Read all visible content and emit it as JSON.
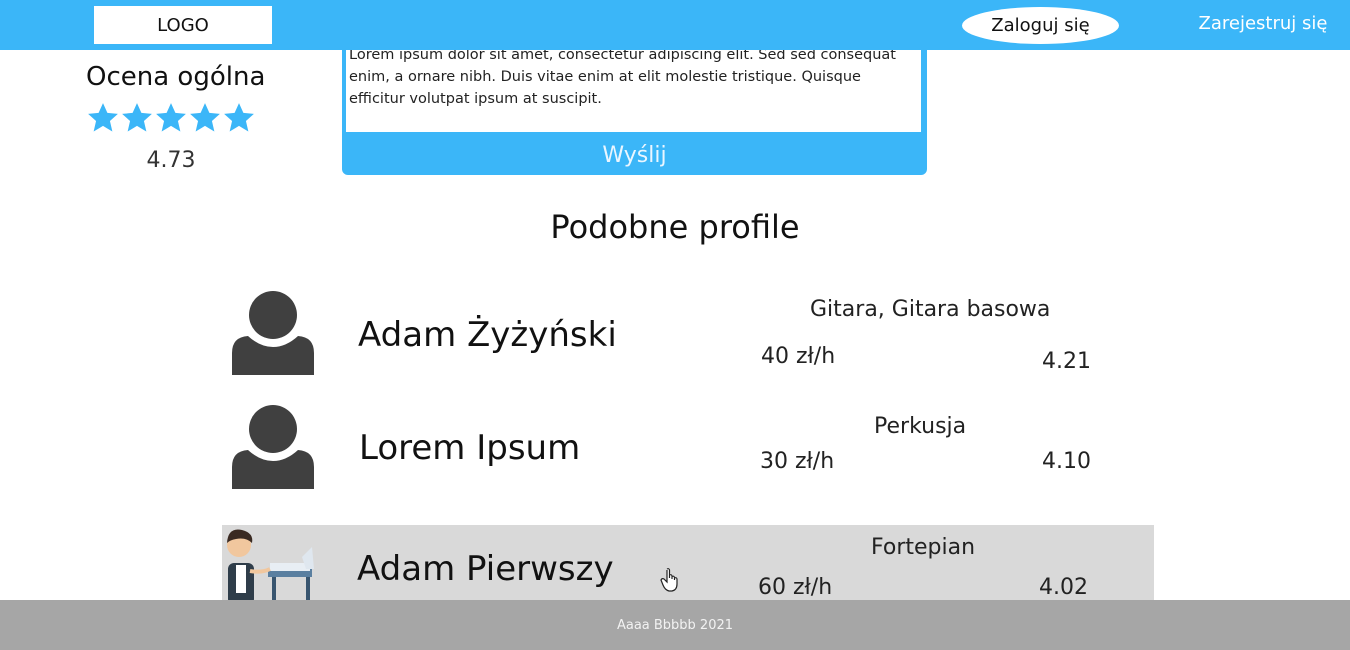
{
  "header": {
    "logo": "LOGO",
    "login_label": "Zaloguj się",
    "register_label": "Zarejestruj się"
  },
  "rating": {
    "title": "Ocena ogólna",
    "stars": 5,
    "value": "4.73"
  },
  "comment_form": {
    "text": "Lorem ipsum dolor sit amet, consectetur adipiscing elit. Sed sed consequat enim, a ornare nibh. Duis vitae enim at elit molestie tristique. Quisque efficitur volutpat ipsum at suscipit.",
    "send_label": "Wyślij"
  },
  "similar": {
    "title": "Podobne profile",
    "profiles": [
      {
        "name": "Adam Żyżyński",
        "instruments": "Gitara, Gitara basowa",
        "price": "40 zł/h",
        "rating": "4.21",
        "avatar": "person-icon"
      },
      {
        "name": "Lorem Ipsum",
        "instruments": "Perkusja",
        "price": "30 zł/h",
        "rating": "4.10",
        "avatar": "person-icon"
      },
      {
        "name": "Adam Pierwszy",
        "instruments": "Fortepian",
        "price": "60 zł/h",
        "rating": "4.02",
        "avatar": "pianist-illustration"
      }
    ]
  },
  "footer": {
    "text": "Aaaa Bbbbb 2021"
  },
  "colors": {
    "accent": "#3bb6f8",
    "footer": "#a6a6a6",
    "highlight_row": "#d9d9d9",
    "avatar": "#404040"
  }
}
